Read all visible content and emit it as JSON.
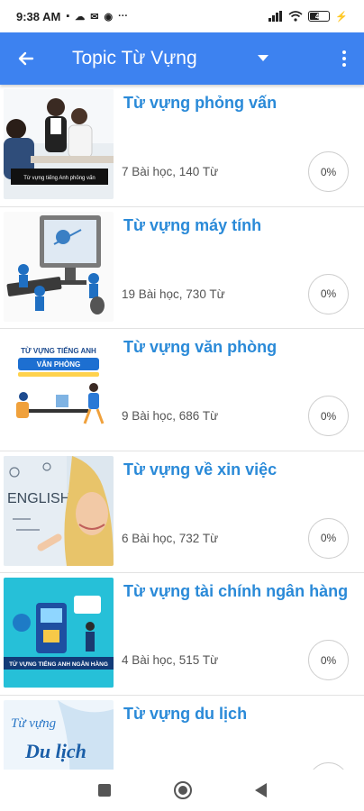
{
  "status_bar": {
    "time": "9:38 AM",
    "overflow": "···",
    "battery": "43"
  },
  "app_bar": {
    "back_icon": "arrow-left-icon",
    "title": "Topic Từ Vựng",
    "dropdown_icon": "caret-down-icon",
    "menu_icon": "more-vertical-icon"
  },
  "topics": [
    {
      "title": "Từ vựng phỏng vấn",
      "meta": "7 Bài học, 140 Từ",
      "progress": "0%",
      "thumb_caption": "Từ vựng tiếng Anh phỏng vấn"
    },
    {
      "title": "Từ vựng máy tính",
      "meta": "19 Bài học, 730 Từ",
      "progress": "0%"
    },
    {
      "title": "Từ vựng văn phòng",
      "meta": "9 Bài học, 686 Từ",
      "progress": "0%",
      "thumb_caption": "TỪ VỰNG TIẾNG ANH",
      "thumb_caption2": "VĂN PHÒNG"
    },
    {
      "title": "Từ vựng về xin việc",
      "meta": "6 Bài học, 732 Từ",
      "progress": "0%",
      "thumb_caption": "ENGLISH"
    },
    {
      "title": "Từ vựng tài chính ngân hàng",
      "meta": "4 Bài học, 515 Từ",
      "progress": "0%",
      "thumb_caption": "TỪ VỰNG TIẾNG ANH NGÂN HÀNG"
    },
    {
      "title": "Từ vựng du lịch",
      "meta": "",
      "progress": "",
      "thumb_caption": "Từ vựng",
      "thumb_caption2": "Du lịch"
    }
  ],
  "colors": {
    "app_bar": "#3d82f0",
    "title_text": "#2a8ad8"
  }
}
